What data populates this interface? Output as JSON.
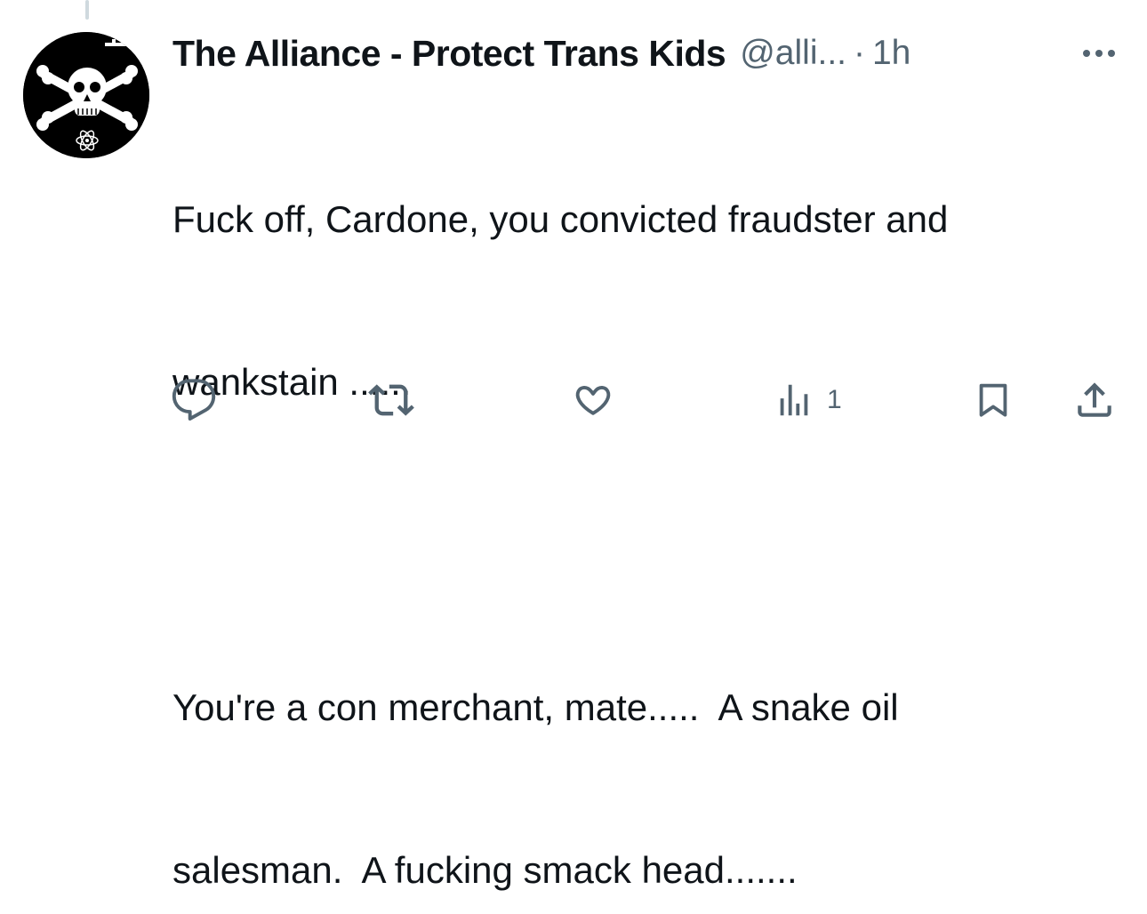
{
  "tweet": {
    "display_name": "The Alliance - Protect Trans Kids",
    "handle": "@alli...",
    "separator": "·",
    "time": "1h",
    "text_lines": [
      "Fuck off, Cardone, you convicted fraudster and",
      "wankstain ......",
      "You're a con merchant, mate.....  A snake oil",
      "salesman.  A fucking smack head......."
    ]
  },
  "actions": {
    "views_count": "1"
  },
  "icons": {
    "more": "more-horizontal-icon",
    "reply": "reply-icon",
    "retweet": "retweet-icon",
    "like": "heart-icon",
    "views": "views-chart-icon",
    "bookmark": "bookmark-icon",
    "share": "share-icon"
  },
  "colors": {
    "text_primary": "#0f1419",
    "text_secondary": "#536471",
    "thread_line": "#cfd9de"
  }
}
